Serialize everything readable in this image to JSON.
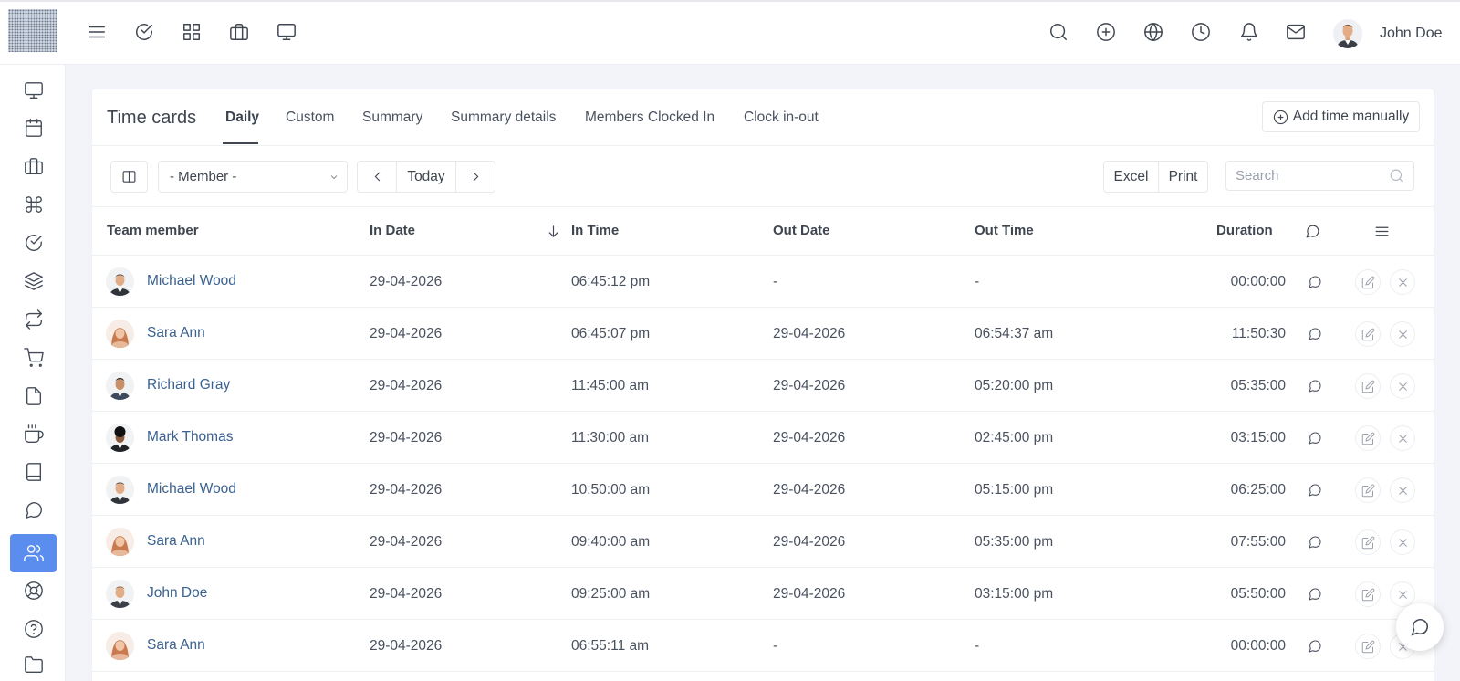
{
  "topbar": {
    "user_name": "John Doe",
    "left_icons": [
      "menu-icon",
      "check-circle-icon",
      "grid-icon",
      "briefcase-icon",
      "monitor-icon"
    ],
    "right_icons": [
      "search-icon",
      "plus-circle-icon",
      "globe-icon",
      "clock-icon",
      "bell-icon",
      "mail-icon"
    ]
  },
  "sidebar": {
    "items": [
      {
        "icon": "monitor-icon"
      },
      {
        "icon": "calendar-icon"
      },
      {
        "icon": "briefcase-icon"
      },
      {
        "icon": "command-icon"
      },
      {
        "icon": "check-circle-icon"
      },
      {
        "icon": "layers-icon"
      },
      {
        "icon": "repeat-icon"
      },
      {
        "icon": "cart-icon"
      },
      {
        "icon": "file-icon"
      },
      {
        "icon": "coffee-icon"
      },
      {
        "icon": "book-icon"
      },
      {
        "icon": "message-circle-icon"
      },
      {
        "icon": "users-icon",
        "active": true
      },
      {
        "icon": "life-buoy-icon"
      },
      {
        "icon": "help-circle-icon"
      },
      {
        "icon": "folder-icon"
      }
    ],
    "active_color": "#5b8def"
  },
  "card": {
    "title": "Time cards",
    "tabs": [
      "Daily",
      "Custom",
      "Summary",
      "Summary details",
      "Members Clocked In",
      "Clock in-out"
    ],
    "active_tab": "Daily",
    "add_time_label": "Add time manually",
    "member_select": "- Member -",
    "today_label": "Today",
    "excel_label": "Excel",
    "print_label": "Print",
    "search_placeholder": "Search"
  },
  "table": {
    "columns": {
      "team_member": "Team member",
      "in_date": "In Date",
      "in_time": "In Time",
      "out_date": "Out Date",
      "out_time": "Out Time",
      "duration": "Duration"
    },
    "rows": [
      {
        "name": "Michael Wood",
        "in_date": "29-04-2026",
        "in_time": "06:45:12 pm",
        "out_date": "-",
        "out_time": "-",
        "duration": "00:00:00"
      },
      {
        "name": "Sara Ann",
        "in_date": "29-04-2026",
        "in_time": "06:45:07 pm",
        "out_date": "29-04-2026",
        "out_time": "06:54:37 am",
        "duration": "11:50:30"
      },
      {
        "name": "Richard Gray",
        "in_date": "29-04-2026",
        "in_time": "11:45:00 am",
        "out_date": "29-04-2026",
        "out_time": "05:20:00 pm",
        "duration": "05:35:00"
      },
      {
        "name": "Mark Thomas",
        "in_date": "29-04-2026",
        "in_time": "11:30:00 am",
        "out_date": "29-04-2026",
        "out_time": "02:45:00 pm",
        "duration": "03:15:00"
      },
      {
        "name": "Michael Wood",
        "in_date": "29-04-2026",
        "in_time": "10:50:00 am",
        "out_date": "29-04-2026",
        "out_time": "05:15:00 pm",
        "duration": "06:25:00"
      },
      {
        "name": "Sara Ann",
        "in_date": "29-04-2026",
        "in_time": "09:40:00 am",
        "out_date": "29-04-2026",
        "out_time": "05:35:00 pm",
        "duration": "07:55:00"
      },
      {
        "name": "John Doe",
        "in_date": "29-04-2026",
        "in_time": "09:25:00 am",
        "out_date": "29-04-2026",
        "out_time": "03:15:00 pm",
        "duration": "05:50:00"
      },
      {
        "name": "Sara Ann",
        "in_date": "29-04-2026",
        "in_time": "06:55:11 am",
        "out_date": "-",
        "out_time": "-",
        "duration": "00:00:00"
      }
    ]
  }
}
